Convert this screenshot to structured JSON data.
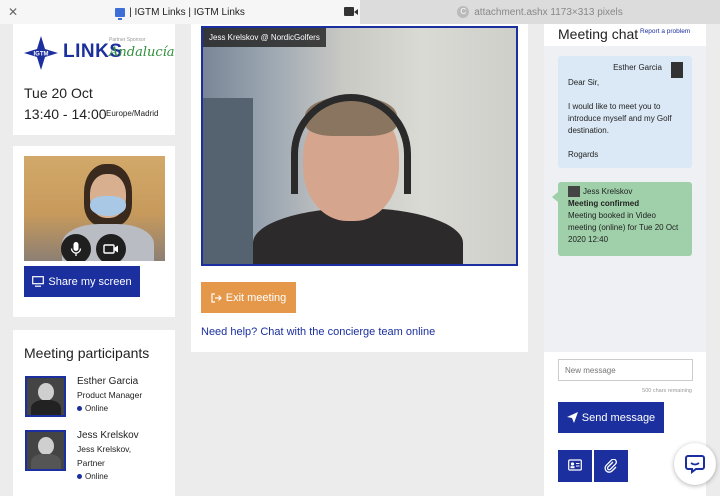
{
  "browser": {
    "active_tab": "| IGTM Links | IGTM Links",
    "inactive_tab": "attachment.ashx 1173×313 pixels",
    "inactive_tab_icon_letter": "C"
  },
  "event": {
    "logo_text": "LINKS",
    "sponsor_small": "Partner Sponsor",
    "sponsor_name": "Andalucía",
    "date": "Tue 20 Oct",
    "time": "13:40 - 14:00",
    "timezone": "Europe/Madrid"
  },
  "self_video": {
    "share_label": "Share my screen"
  },
  "participants": {
    "title": "Meeting participants",
    "list": [
      {
        "name": "Esther Garcia",
        "role": "Product Manager",
        "status": "Online"
      },
      {
        "name": "Jess Krelskov",
        "role": "Jess Krelskov,",
        "role2": "Partner",
        "status": "Online"
      }
    ]
  },
  "main": {
    "video_label": "Jess Krelskov @ NordicGolfers",
    "exit_label": "Exit meeting",
    "help_text": "Need help? Chat with the concierge team online"
  },
  "chat": {
    "title": "Meeting chat",
    "report_label": "Report a problem",
    "incoming": {
      "sender": "Esther Garcia",
      "greeting": "Dear Sir,",
      "body": "I would like to meet you to introduce myself and my Golf destination.",
      "signoff": "Rogards"
    },
    "outgoing": {
      "sender": "Jess Krelskov",
      "heading": "Meeting confirmed",
      "body": "Meeting booked in Video meeting (online) for Tue 20 Oct 2020 12:40"
    },
    "input_placeholder": "New message",
    "chars_remaining": "500 chars remaining",
    "send_label": "Send message"
  },
  "colors": {
    "brand_blue": "#1b2f9e",
    "exit_orange": "#e5984a",
    "incoming_bubble": "#dbe9f6",
    "outgoing_bubble": "#9fd0a9"
  }
}
